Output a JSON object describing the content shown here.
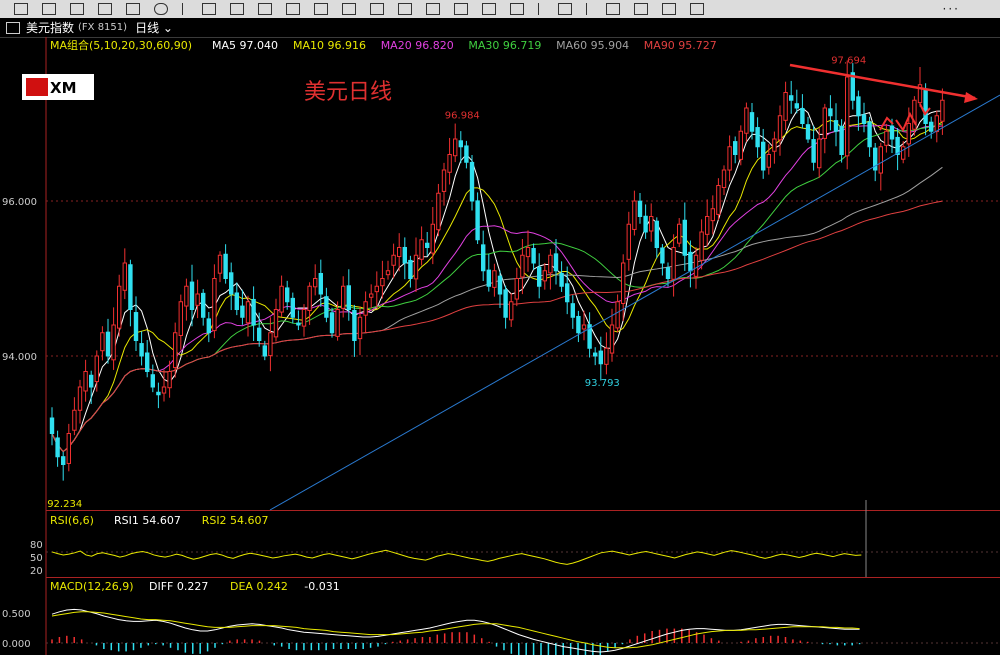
{
  "window": {
    "title": "美元指数",
    "code": "(FX 8151)",
    "period": "日线"
  },
  "toolbar": {
    "more_label": "···"
  },
  "logo": {
    "text": "XM"
  },
  "annotation": {
    "title": "美元日线"
  },
  "main_legend": {
    "name": "MA组合(5,10,20,30,60,90)",
    "items": [
      {
        "label": "MA5 97.040",
        "color": "#ffffff"
      },
      {
        "label": "MA10 96.916",
        "color": "#e8e800"
      },
      {
        "label": "MA20 96.820",
        "color": "#e040e0"
      },
      {
        "label": "MA30 96.719",
        "color": "#40d040"
      },
      {
        "label": "MA60 95.904",
        "color": "#a0a0a0"
      },
      {
        "label": "MA90 95.727",
        "color": "#e04040"
      }
    ]
  },
  "rsi_legend": {
    "name": "RSI(6,6)",
    "items": [
      {
        "label": "RSI1 54.607",
        "color": "#ffffff"
      },
      {
        "label": "RSI2 54.607",
        "color": "#e8e800"
      }
    ]
  },
  "macd_legend": {
    "name": "MACD(12,26,9)",
    "items": [
      {
        "label": "DIFF 0.227",
        "color": "#ffffff"
      },
      {
        "label": "DEA 0.242",
        "color": "#e8e800"
      },
      {
        "label": "-0.031",
        "color": "#ffffff"
      }
    ]
  },
  "chart_data": {
    "type": "candlestick",
    "price_axis": {
      "ticks": [
        "96.000",
        "94.000"
      ],
      "ylim": [
        92.0,
        98.2
      ]
    },
    "rsi_axis": {
      "ticks": [
        "80",
        "50",
        "20"
      ]
    },
    "macd_axis": {
      "ticks": [
        "0.500",
        "0.000"
      ]
    },
    "labels": {
      "high_right": {
        "text": "97.694",
        "value": 97.694,
        "index": 142
      },
      "high_left": {
        "text": "96.984",
        "value": 96.984,
        "index": 73
      },
      "low_mid": {
        "text": "93.793",
        "value": 93.793,
        "index": 98
      },
      "low_start": {
        "text": "92.234",
        "value": 92.234,
        "index": 2
      }
    },
    "series_colors": {
      "up": "#f03030",
      "down": "#30e0f0",
      "ma5": "#ffffff",
      "ma10": "#e8e800",
      "ma20": "#e040e0",
      "ma30": "#40d040",
      "ma60": "#a0a0a0",
      "ma90": "#e04040",
      "trend": "#2a7ad0",
      "resistance": "#f03030"
    },
    "close": [
      93.0,
      92.7,
      92.6,
      93.0,
      93.3,
      93.6,
      93.8,
      93.6,
      94.0,
      94.3,
      94.0,
      94.4,
      94.9,
      95.2,
      94.6,
      94.2,
      94.0,
      93.8,
      93.6,
      93.5,
      93.6,
      93.8,
      94.3,
      94.7,
      94.9,
      94.6,
      94.8,
      94.5,
      94.3,
      95.0,
      95.3,
      95.0,
      94.8,
      94.6,
      94.5,
      94.7,
      94.4,
      94.2,
      94.0,
      94.3,
      94.6,
      94.9,
      94.7,
      94.5,
      94.4,
      94.6,
      94.9,
      95.0,
      94.8,
      94.5,
      94.3,
      94.6,
      94.9,
      94.6,
      94.2,
      94.5,
      94.7,
      94.8,
      94.9,
      95.0,
      95.1,
      95.3,
      95.4,
      95.2,
      95.0,
      95.3,
      95.5,
      95.4,
      95.7,
      96.1,
      96.4,
      96.6,
      96.8,
      96.7,
      96.5,
      96.0,
      95.5,
      95.1,
      94.9,
      95.1,
      94.8,
      94.5,
      94.7,
      95.0,
      95.3,
      95.4,
      95.2,
      94.9,
      95.1,
      95.3,
      95.1,
      94.9,
      94.7,
      94.5,
      94.3,
      94.4,
      94.1,
      94.0,
      93.9,
      94.1,
      94.4,
      94.7,
      95.2,
      95.7,
      96.0,
      95.8,
      95.6,
      95.8,
      95.4,
      95.2,
      95.0,
      95.4,
      95.7,
      95.3,
      95.1,
      95.3,
      95.6,
      95.8,
      95.9,
      96.2,
      96.4,
      96.7,
      96.6,
      96.9,
      97.2,
      96.9,
      96.7,
      96.4,
      96.6,
      96.8,
      97.1,
      97.4,
      97.3,
      97.2,
      97.0,
      96.8,
      96.5,
      96.8,
      97.2,
      97.1,
      96.9,
      96.6,
      97.6,
      97.3,
      97.1,
      97.0,
      96.7,
      96.4,
      96.7,
      96.9,
      96.8,
      96.6,
      96.7,
      97.0,
      97.3,
      97.5,
      97.0,
      96.9,
      97.1,
      97.3
    ],
    "rsi": [
      62,
      58,
      55,
      57,
      60,
      64,
      55,
      52,
      58,
      60,
      57,
      54,
      50,
      53,
      58,
      61,
      63,
      60,
      55,
      52,
      50,
      53,
      57,
      54,
      49,
      45,
      48,
      52,
      56,
      58,
      55,
      50,
      47,
      52,
      56,
      59,
      57,
      54,
      51,
      48,
      50,
      53,
      55,
      57,
      54,
      50,
      48,
      52,
      56,
      58,
      55,
      52,
      49,
      46,
      49,
      53,
      57,
      60,
      63,
      66,
      62,
      58,
      54,
      50,
      47,
      45,
      43,
      47,
      52,
      55,
      58,
      56,
      53,
      50,
      47,
      45,
      42,
      40,
      43,
      47,
      50,
      53,
      56,
      58,
      55,
      52,
      49,
      46,
      42,
      38,
      35,
      33,
      36,
      40,
      45,
      50,
      55,
      60,
      62,
      64,
      61,
      58,
      55,
      58,
      61,
      63,
      60,
      57,
      54,
      51,
      48,
      52,
      56,
      59,
      62,
      60,
      57,
      54,
      58,
      62,
      65,
      63,
      60,
      57,
      54,
      50,
      47,
      50,
      54,
      57,
      55,
      52,
      49,
      52,
      56,
      59,
      57,
      54,
      51,
      55,
      58,
      56,
      54,
      55
    ],
    "macd_diff": [
      0.48,
      0.52,
      0.55,
      0.56,
      0.55,
      0.52,
      0.49,
      0.45,
      0.42,
      0.39,
      0.37,
      0.36,
      0.36,
      0.37,
      0.38,
      0.36,
      0.33,
      0.29,
      0.25,
      0.22,
      0.2,
      0.2,
      0.22,
      0.25,
      0.28,
      0.3,
      0.31,
      0.32,
      0.31,
      0.29,
      0.27,
      0.25,
      0.22,
      0.2,
      0.18,
      0.17,
      0.16,
      0.15,
      0.14,
      0.13,
      0.12,
      0.11,
      0.1,
      0.1,
      0.11,
      0.13,
      0.15,
      0.17,
      0.19,
      0.21,
      0.23,
      0.25,
      0.28,
      0.31,
      0.34,
      0.36,
      0.38,
      0.38,
      0.36,
      0.33,
      0.29,
      0.24,
      0.19,
      0.14,
      0.1,
      0.06,
      0.03,
      0.0,
      -0.03,
      -0.06,
      -0.08,
      -0.1,
      -0.12,
      -0.14,
      -0.15,
      -0.14,
      -0.12,
      -0.09,
      -0.05,
      -0.01,
      0.03,
      0.07,
      0.11,
      0.15,
      0.18,
      0.21,
      0.23,
      0.24,
      0.24,
      0.23,
      0.22,
      0.21,
      0.21,
      0.22,
      0.24,
      0.26,
      0.28,
      0.3,
      0.31,
      0.31,
      0.3,
      0.29,
      0.28,
      0.27,
      0.26,
      0.25,
      0.24,
      0.23,
      0.23,
      0.23
    ],
    "macd_dea": [
      0.45,
      0.47,
      0.49,
      0.51,
      0.52,
      0.52,
      0.51,
      0.5,
      0.48,
      0.46,
      0.44,
      0.42,
      0.4,
      0.39,
      0.39,
      0.38,
      0.37,
      0.35,
      0.33,
      0.31,
      0.29,
      0.27,
      0.26,
      0.26,
      0.26,
      0.27,
      0.28,
      0.29,
      0.29,
      0.29,
      0.29,
      0.28,
      0.27,
      0.26,
      0.24,
      0.23,
      0.22,
      0.21,
      0.19,
      0.18,
      0.17,
      0.16,
      0.15,
      0.14,
      0.14,
      0.14,
      0.14,
      0.15,
      0.16,
      0.17,
      0.18,
      0.2,
      0.21,
      0.23,
      0.25,
      0.27,
      0.29,
      0.31,
      0.32,
      0.32,
      0.32,
      0.3,
      0.28,
      0.26,
      0.23,
      0.2,
      0.17,
      0.14,
      0.11,
      0.08,
      0.05,
      0.02,
      0.0,
      -0.03,
      -0.05,
      -0.07,
      -0.08,
      -0.08,
      -0.08,
      -0.07,
      -0.05,
      -0.03,
      0.0,
      0.03,
      0.06,
      0.09,
      0.12,
      0.15,
      0.17,
      0.19,
      0.2,
      0.21,
      0.21,
      0.21,
      0.22,
      0.22,
      0.23,
      0.24,
      0.25,
      0.26,
      0.27,
      0.27,
      0.27,
      0.27,
      0.27,
      0.26,
      0.26,
      0.25,
      0.25,
      0.24
    ]
  }
}
